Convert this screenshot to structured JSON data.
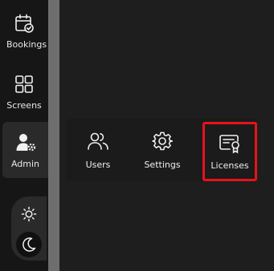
{
  "sidebar": {
    "items": [
      {
        "label": "Bookings",
        "icon": "calendar-check-icon"
      },
      {
        "label": "Screens",
        "icon": "grid-icon"
      },
      {
        "label": "Admin",
        "icon": "user-gear-icon",
        "active": true
      }
    ],
    "theme": {
      "light_icon": "sun-icon",
      "dark_icon": "moon-icon",
      "selected": "dark"
    }
  },
  "admin_menu": {
    "items": [
      {
        "label": "Users",
        "icon": "users-icon"
      },
      {
        "label": "Settings",
        "icon": "gear-icon"
      },
      {
        "label": "Licenses",
        "icon": "certificate-icon",
        "highlighted": true
      }
    ]
  },
  "colors": {
    "background": "#1e1e1e",
    "sidebar": "#161616",
    "divider": "#6e6e6e",
    "highlight": "#e8121a"
  }
}
